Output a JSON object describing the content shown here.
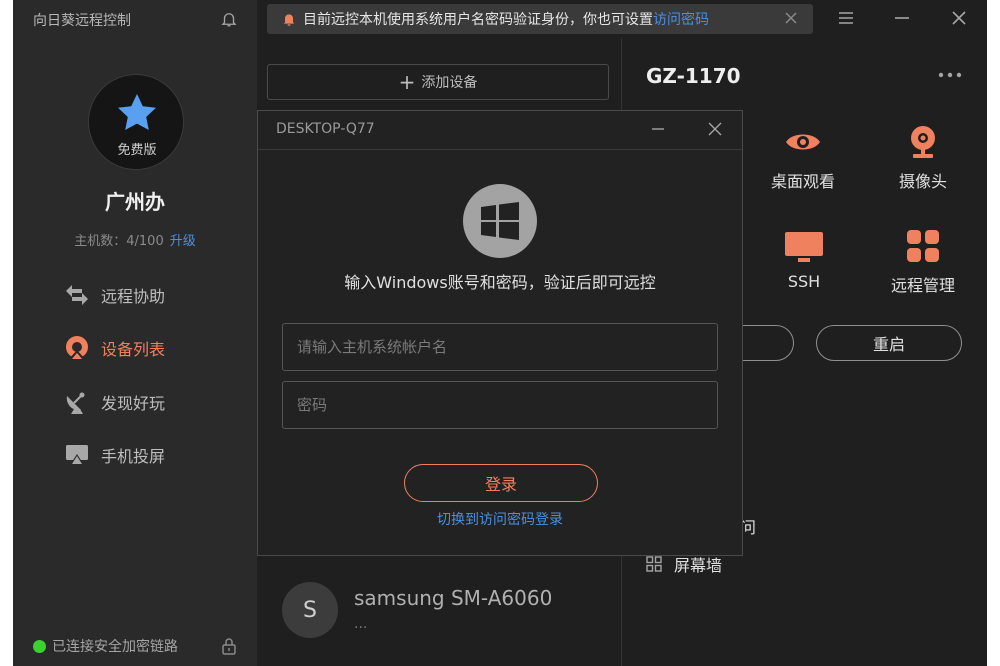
{
  "sidebar": {
    "app_title": "向日葵远程控制",
    "plan": "免费版",
    "group_name": "广州办",
    "host_count": "主机数：4/100",
    "upgrade": "升级",
    "nav": [
      {
        "label": "远程协助",
        "icon": "swap-arrows-icon",
        "active": false
      },
      {
        "label": "设备列表",
        "icon": "sunflower-device-icon",
        "active": true
      },
      {
        "label": "发现好玩",
        "icon": "satellite-dish-icon",
        "active": false
      },
      {
        "label": "手机投屏",
        "icon": "screen-cast-icon",
        "active": false
      }
    ],
    "connection_status": "已连接安全加密链路"
  },
  "notice": {
    "text": "目前远控本机使用系统用户名密码验证身份，你也可设置",
    "link": "访问密码"
  },
  "device_list": {
    "add_label": "添加设备",
    "devices": [
      {
        "initial": "S",
        "name": "samsung SM-A6060",
        "sub": "..."
      }
    ]
  },
  "device_panel": {
    "title": "GZ-1170",
    "actions": [
      {
        "label": "桌面观看",
        "icon": "eye-icon"
      },
      {
        "label": "摄像头",
        "icon": "webcam-icon"
      },
      {
        "label": "SSH",
        "icon": "monitor-icon"
      },
      {
        "label": "远程管理",
        "icon": "grid-apps-icon"
      }
    ],
    "restart_label": "重启",
    "partial_label": "问",
    "screen_wall_label": "屏幕墙"
  },
  "login_dialog": {
    "title": "DESKTOP-Q77",
    "prompt": "输入Windows账号和密码，验证后即可远控",
    "username_placeholder": "请输入主机系统帐户名",
    "password_placeholder": "密码",
    "login_label": "登录",
    "switch_label": "切换到访问密码登录"
  },
  "colors": {
    "accent": "#f0815e",
    "link": "#4b8fe0",
    "online": "#3bd12f",
    "icon_blue": "#5aa0f0",
    "background": "#1f1f1f",
    "sidebar": "#2a2a2a"
  }
}
